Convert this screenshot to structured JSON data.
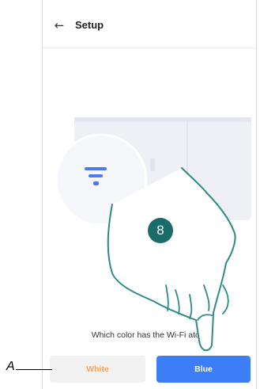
{
  "header": {
    "back_icon": "arrow-left-icon",
    "title": "Setup"
  },
  "main": {
    "question": "Which color has the Wi-Fi       ator?",
    "buttons": [
      {
        "label": "White",
        "text_color": "#f5a35c",
        "bg": "#f2f2f2"
      },
      {
        "label": "Blue",
        "text_color": "#ffffff",
        "bg": "#3d7df6"
      }
    ]
  },
  "overlay": {
    "callout_label": "A",
    "step_number": "8"
  }
}
